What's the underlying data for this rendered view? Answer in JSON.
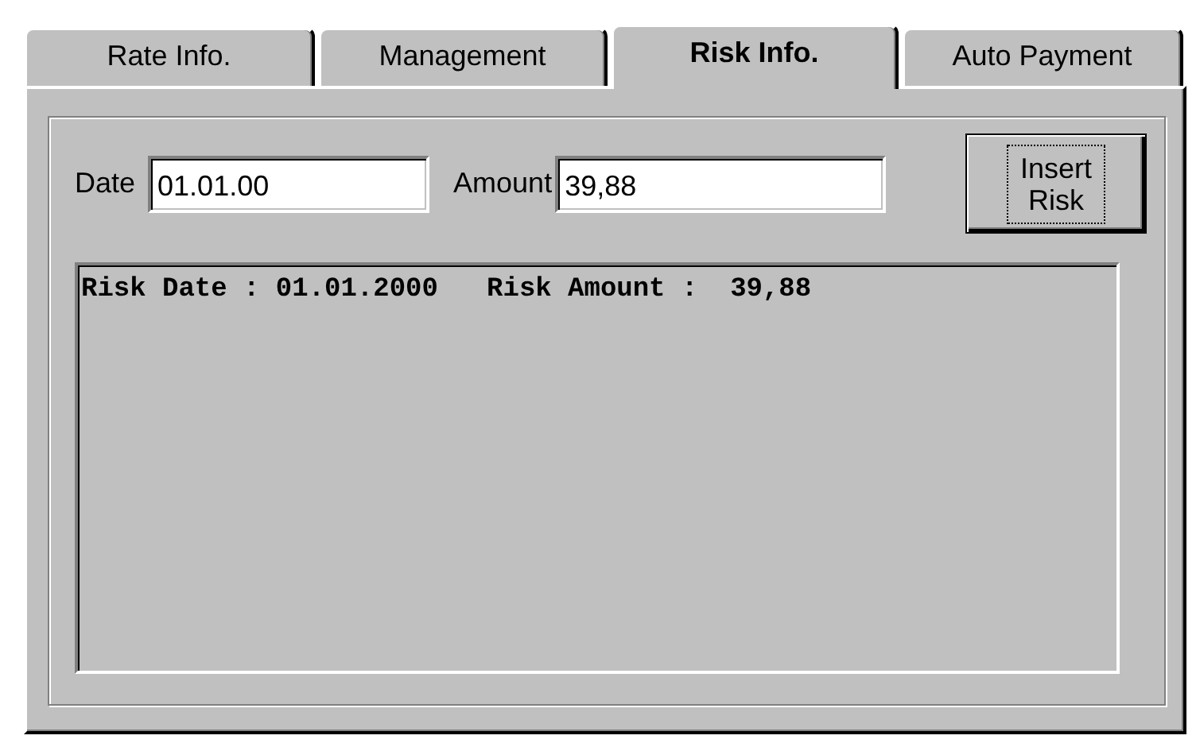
{
  "tabs": [
    {
      "label": "Rate Info.",
      "selected": false
    },
    {
      "label": "Management",
      "selected": false
    },
    {
      "label": "Risk Info.",
      "selected": true
    },
    {
      "label": "Auto Payment",
      "selected": false
    }
  ],
  "date": {
    "label": "Date",
    "value": "01.01.00"
  },
  "amount": {
    "label": "Amount",
    "value": "39,88"
  },
  "insert_button": {
    "label": "Insert Risk",
    "focused": true
  },
  "risk_list": [
    "Risk Date : 01.01.2000   Risk Amount :  39,88"
  ]
}
